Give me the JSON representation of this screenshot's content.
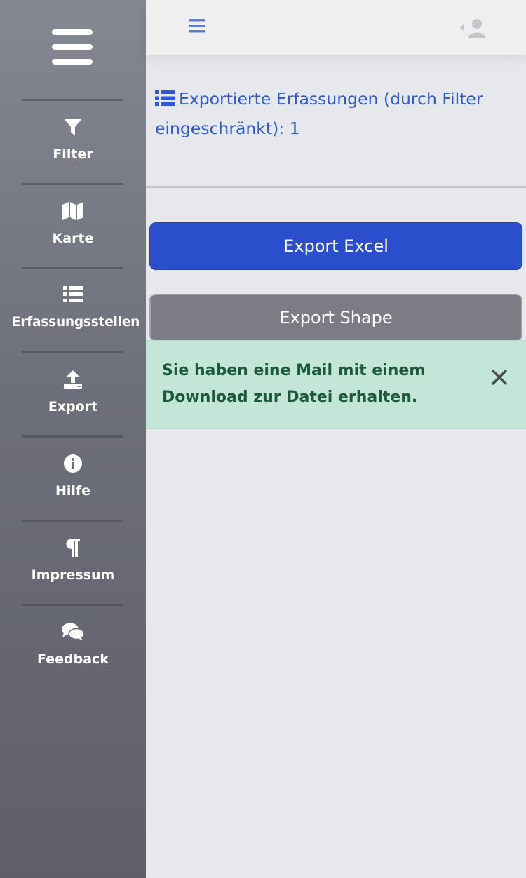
{
  "sidebar": {
    "items": [
      {
        "label": "Filter",
        "icon": "filter-icon"
      },
      {
        "label": "Karte",
        "icon": "map-icon"
      },
      {
        "label": "Erfassungsstellen",
        "icon": "list-icon"
      },
      {
        "label": "Export",
        "icon": "upload-icon"
      },
      {
        "label": "Hilfe",
        "icon": "info-icon"
      },
      {
        "label": "Impressum",
        "icon": "paragraph-icon"
      },
      {
        "label": "Feedback",
        "icon": "comments-icon"
      }
    ]
  },
  "topbar": {
    "toggle_icon": "bars-icon",
    "user_icon": "user-icon"
  },
  "main": {
    "heading": "Exportierte Erfassungen (durch Filter eingeschränkt): 1",
    "export_excel_label": "Export Excel",
    "export_shape_label": "Export Shape"
  },
  "alert": {
    "message": "Sie haben eine Mail mit einem Download zur Datei erhalten."
  },
  "colors": {
    "primary": "#2b4fcc",
    "link": "#2c59d8",
    "secondary": "#7b7c86",
    "success_bg": "#c4e6d8",
    "success_text": "#1c5a3c"
  }
}
